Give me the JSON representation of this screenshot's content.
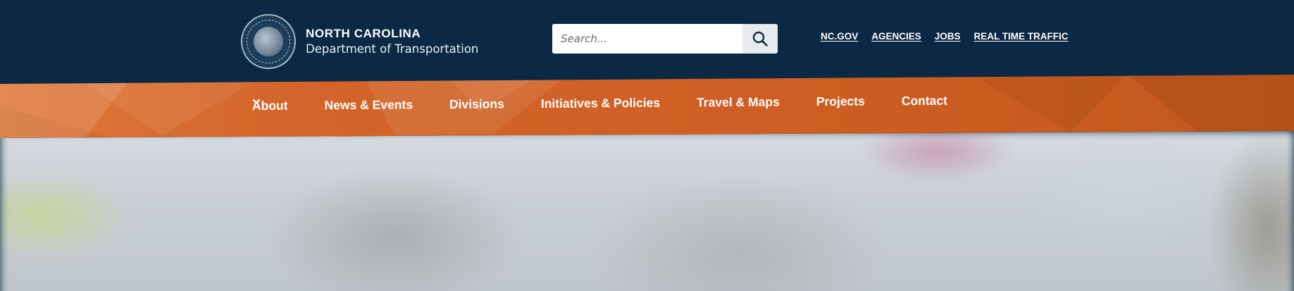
{
  "brand": {
    "title": "NORTH CAROLINA",
    "subtitle": "Department of Transportation",
    "seal_icon": "nc-state-seal-icon"
  },
  "search": {
    "placeholder": "Search...",
    "value": "",
    "button_icon": "search-icon"
  },
  "utility_links": [
    "NC.GOV",
    "AGENCIES",
    "JOBS",
    "REAL TIME TRAFFIC"
  ],
  "nav": {
    "items": [
      {
        "label": "About",
        "has_dropdown": true
      },
      {
        "label": "News & Events",
        "has_dropdown": true
      },
      {
        "label": "Divisions",
        "has_dropdown": true
      },
      {
        "label": "Initiatives & Policies",
        "has_dropdown": true
      },
      {
        "label": "Travel & Maps",
        "has_dropdown": true
      },
      {
        "label": "Projects",
        "has_dropdown": true
      },
      {
        "label": "Contact",
        "has_dropdown": false
      }
    ]
  },
  "colors": {
    "header_bg": "#0b2944",
    "nav_bg": "#d4652a",
    "text_light": "#ffffff"
  }
}
